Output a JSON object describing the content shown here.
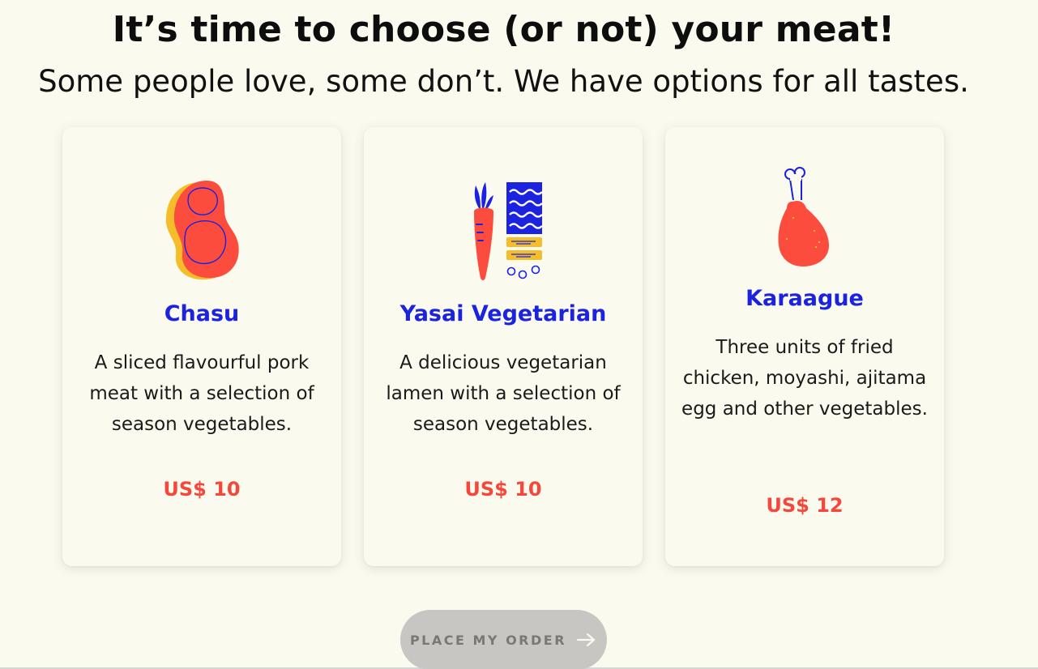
{
  "header": {
    "title": "It’s time to choose (or not) your meat!",
    "subtitle": "Some people love, some don’t. We have options for all tastes."
  },
  "cards": [
    {
      "name": "Chasu",
      "description": "A sliced flavourful pork meat with a selection of season vegetables.",
      "price": "US$ 10",
      "icon": "pork-meat-icon"
    },
    {
      "name": "Yasai Vegetarian",
      "description": "A delicious vegetarian lamen with a selection of season vegetables.",
      "price": "US$ 10",
      "icon": "carrot-vegetables-icon"
    },
    {
      "name": "Karaague",
      "description": "Three units of fried chicken, moyashi, ajitama egg and other vegetables.",
      "price": "US$ 12",
      "icon": "chicken-drumstick-icon"
    }
  ],
  "order_button": {
    "label": "PLACE MY ORDER",
    "icon": "arrow-right-icon"
  },
  "colors": {
    "background": "#fbfaee",
    "accent_blue": "#1b22e0",
    "price_red": "#f4483c",
    "meat_red": "#fc4c3d",
    "meat_yellow": "#f6bd2b",
    "button_gray": "#c8c6c3"
  }
}
